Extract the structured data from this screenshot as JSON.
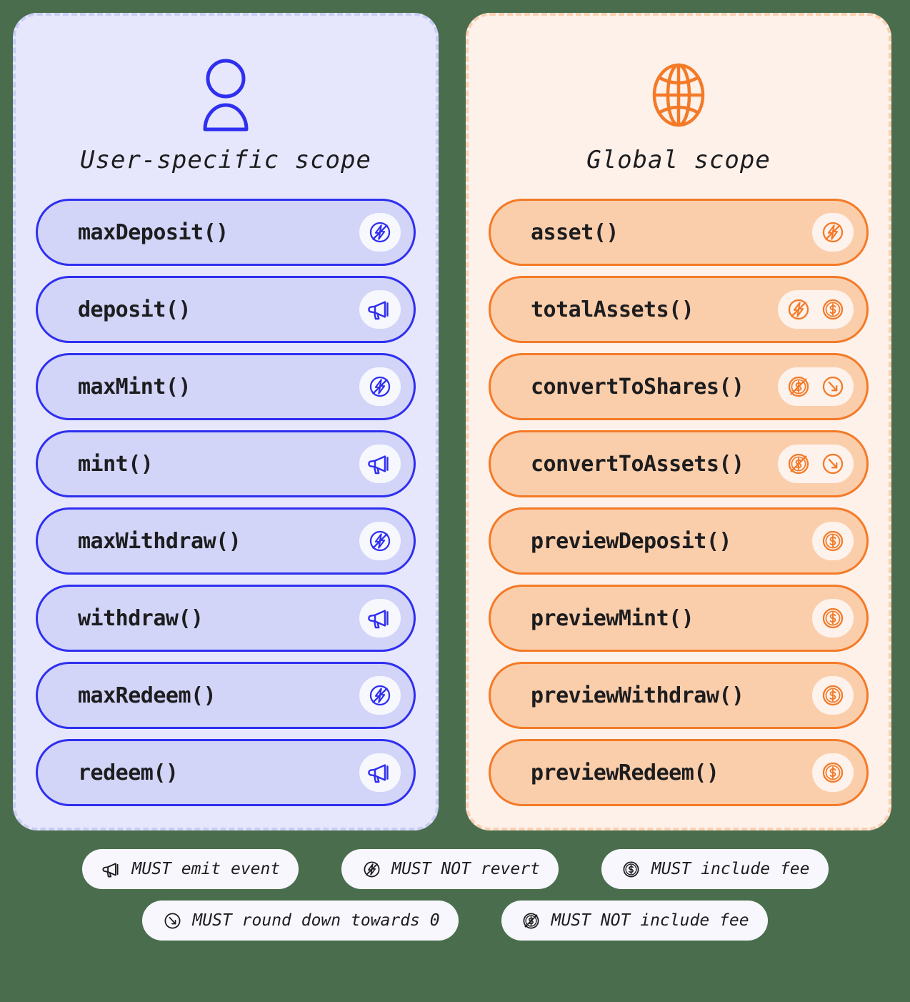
{
  "colors": {
    "background": "#4a6e4d",
    "user_panel_bg": "#e6e7fc",
    "user_panel_border": "#c9cdf5",
    "user_accent": "#2f2ff0",
    "user_row_bg": "#d2d4f8",
    "global_panel_bg": "#fdf1ea",
    "global_panel_border": "#fbcfb0",
    "global_accent": "#f47a27",
    "global_row_bg": "#fbceab",
    "chip_bg": "#f7f7fd",
    "text": "#1d1d1f"
  },
  "panels": [
    {
      "id": "user-specific",
      "title": "User-specific scope",
      "icon": "user-icon",
      "rows": [
        {
          "label": "maxDeposit()",
          "badges": [
            "must-not-revert-icon"
          ]
        },
        {
          "label": "deposit()",
          "badges": [
            "must-emit-event-icon"
          ]
        },
        {
          "label": "maxMint()",
          "badges": [
            "must-not-revert-icon"
          ]
        },
        {
          "label": "mint()",
          "badges": [
            "must-emit-event-icon"
          ]
        },
        {
          "label": "maxWithdraw()",
          "badges": [
            "must-not-revert-icon"
          ]
        },
        {
          "label": "withdraw()",
          "badges": [
            "must-emit-event-icon"
          ]
        },
        {
          "label": "maxRedeem()",
          "badges": [
            "must-not-revert-icon"
          ]
        },
        {
          "label": "redeem()",
          "badges": [
            "must-emit-event-icon"
          ]
        }
      ]
    },
    {
      "id": "global",
      "title": "Global scope",
      "icon": "globe-icon",
      "rows": [
        {
          "label": "asset()",
          "badges": [
            "must-not-revert-icon"
          ]
        },
        {
          "label": "totalAssets()",
          "badges": [
            "must-not-revert-icon",
            "must-include-fee-icon"
          ]
        },
        {
          "label": "convertToShares()",
          "badges": [
            "must-not-include-fee-icon",
            "must-round-down-icon"
          ]
        },
        {
          "label": "convertToAssets()",
          "badges": [
            "must-not-include-fee-icon",
            "must-round-down-icon"
          ]
        },
        {
          "label": "previewDeposit()",
          "badges": [
            "must-include-fee-icon"
          ]
        },
        {
          "label": "previewMint()",
          "badges": [
            "must-include-fee-icon"
          ]
        },
        {
          "label": "previewWithdraw()",
          "badges": [
            "must-include-fee-icon"
          ]
        },
        {
          "label": "previewRedeem()",
          "badges": [
            "must-include-fee-icon"
          ]
        }
      ]
    }
  ],
  "legend": {
    "rows": [
      [
        {
          "icon": "must-emit-event-icon",
          "label": "MUST emit event"
        },
        {
          "icon": "must-not-revert-icon",
          "label": "MUST NOT revert"
        },
        {
          "icon": "must-include-fee-icon",
          "label": "MUST include fee"
        }
      ],
      [
        {
          "icon": "must-round-down-icon",
          "label": "MUST round down towards 0"
        },
        {
          "icon": "must-not-include-fee-icon",
          "label": "MUST NOT include fee"
        }
      ]
    ]
  }
}
